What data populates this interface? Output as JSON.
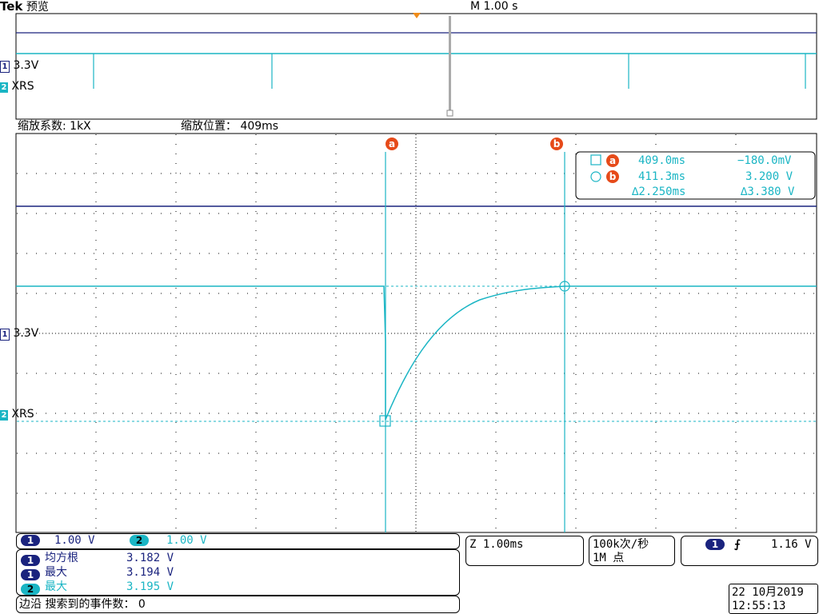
{
  "header": {
    "brand": "Tek",
    "mode": "预览",
    "timebase": "M 1.00 s"
  },
  "overview": {
    "ch1_label": "3.3V",
    "ch2_label": "XRS",
    "ch1_num": "1",
    "ch2_num": "2"
  },
  "zoom_bar": {
    "factor_label": "缩放系数: 1kX",
    "position_label": "缩放位置： 409ms"
  },
  "main": {
    "ch1_label": "3.3V",
    "ch2_label": "XRS",
    "ch1_num": "1",
    "ch2_num": "2",
    "cursor_a_tag": "a",
    "cursor_b_tag": "b"
  },
  "cursor_readout": {
    "a": {
      "tag": "a",
      "time": "409.0ms",
      "value": "−180.0mV"
    },
    "b": {
      "tag": "b",
      "time": "411.3ms",
      "value": "3.200 V"
    },
    "delta_time": "∆2.250ms",
    "delta_value": "∆3.380 V"
  },
  "bottom": {
    "ch1_scale": {
      "num": "1",
      "value": "1.00 V"
    },
    "ch2_scale": {
      "num": "2",
      "value": "1.00 V"
    },
    "measurements": [
      {
        "num": "1",
        "name": "均方根",
        "value": "3.182 V",
        "color": "#1a237e"
      },
      {
        "num": "1",
        "name": "最大",
        "value": "3.194 V",
        "color": "#1a237e"
      },
      {
        "num": "2",
        "name": "最大",
        "value": "3.195 V",
        "color": "#1ab5c4"
      }
    ],
    "search_label": "边沿 搜索到的事件数： 0",
    "zoom_timebase": "Z 1.00ms",
    "sample_rate": "100k次/秒",
    "record_length": "1M 点",
    "trigger": {
      "num": "1",
      "symbol": "⨍",
      "level": "1.16 V"
    },
    "date": "22 10月2019",
    "time": "12:55:13"
  },
  "colors": {
    "ch1": "#1a237e",
    "ch2": "#1ab5c4",
    "cursor_tag": "#e64a19",
    "trigger_marker": "#ef8c1a"
  }
}
